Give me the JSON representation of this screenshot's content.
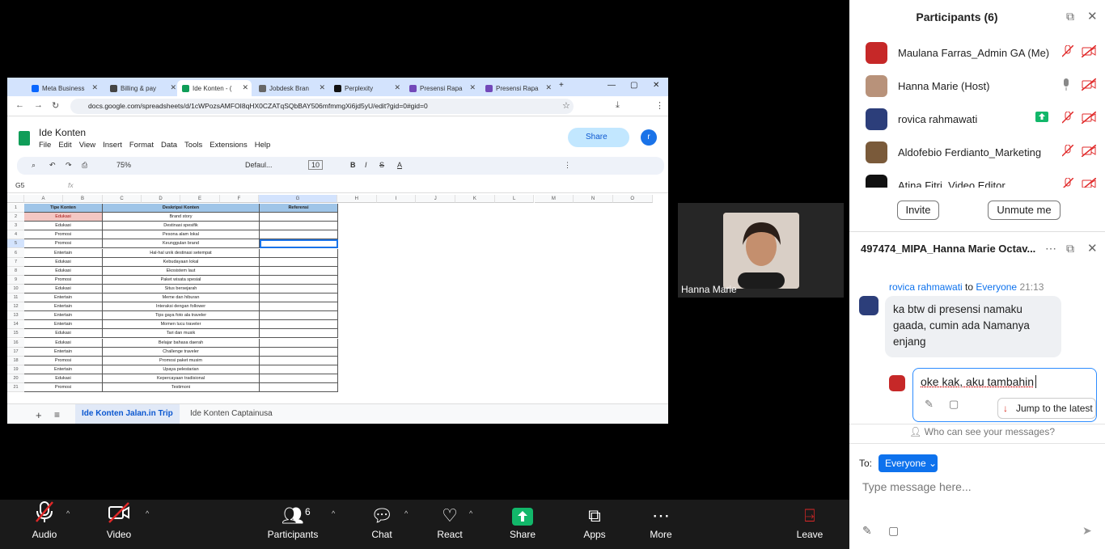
{
  "browser": {
    "tabs": [
      {
        "label": "Meta Business",
        "color": "#0866ff"
      },
      {
        "label": "Billing & pay",
        "color": "#444"
      },
      {
        "label": "Ide Konten - (",
        "color": "#0f9d58"
      },
      {
        "label": "Jobdesk Bran",
        "color": "#666"
      },
      {
        "label": "Perplexity",
        "color": "#111"
      },
      {
        "label": "Presensi Rapa",
        "color": "#7248b9"
      },
      {
        "label": "Presensi Rapa",
        "color": "#7248b9"
      }
    ],
    "url": "docs.google.com/spreadsheets/d/1cWPozsAMFOI8qHX0CZATqSQbBAY506mfmmgXi6jd5yU/edit?gid=0#gid=0"
  },
  "sheet": {
    "title": "Ide Konten",
    "menus": [
      "File",
      "Edit",
      "View",
      "Insert",
      "Format",
      "Data",
      "Tools",
      "Extensions",
      "Help"
    ],
    "share_label": "Share",
    "avatar_letter": "r",
    "zoom": "75%",
    "font": "Defaul...",
    "font_size": "10",
    "cell_ref": "G5",
    "fx": "fx",
    "columns": [
      "A",
      "B",
      "C",
      "D",
      "E",
      "F",
      "G",
      "H",
      "I",
      "J",
      "K",
      "L",
      "M",
      "N",
      "O"
    ],
    "headers": {
      "tipe": "Tipe Konten",
      "deskripsi": "Deskripsi Konten",
      "referensi": "Referensi"
    },
    "rows": [
      {
        "tipe": "Edukasi",
        "desc": "Brand story"
      },
      {
        "tipe": "Edukasi",
        "desc": "Destinasi spesifik"
      },
      {
        "tipe": "Promosi",
        "desc": "Pesona alam lokal"
      },
      {
        "tipe": "Promosi",
        "desc": "Keunggulan brand"
      },
      {
        "tipe": "Entertain",
        "desc": "Hal-hal unik destinasi setempat"
      },
      {
        "tipe": "Edukasi",
        "desc": "Kebudayaan lokal"
      },
      {
        "tipe": "Edukasi",
        "desc": "Ekosistem laut"
      },
      {
        "tipe": "Promosi",
        "desc": "Paket wisata spesial"
      },
      {
        "tipe": "Edukasi",
        "desc": "Situs bersejarah"
      },
      {
        "tipe": "Entertain",
        "desc": "Meme dan hiburan"
      },
      {
        "tipe": "Entertain",
        "desc": "Interaksi dengan follower"
      },
      {
        "tipe": "Entertain",
        "desc": "Tips gaya foto ala traveler"
      },
      {
        "tipe": "Entertain",
        "desc": "Momen lucu traveler"
      },
      {
        "tipe": "Edukasi",
        "desc": "Tari dan musik"
      },
      {
        "tipe": "Edukasi",
        "desc": "Belajar bahasa daerah"
      },
      {
        "tipe": "Entertain",
        "desc": "Challenge traveler"
      },
      {
        "tipe": "Promosi",
        "desc": "Promosi paket musim"
      },
      {
        "tipe": "Entertain",
        "desc": "Upaya pelestarian"
      },
      {
        "tipe": "Edukasi",
        "desc": "Kepercayaan tradisional"
      },
      {
        "tipe": "Promosi",
        "desc": "Testimoni"
      }
    ],
    "sheet_tabs": [
      "Ide Konten Jalan.in Trip",
      "Ide Konten Captainusa"
    ]
  },
  "video": {
    "name": "Hanna Marie"
  },
  "participants": {
    "title": "Participants (6)",
    "list": [
      {
        "name": "Maulana Farras_Admin GA (Me)",
        "color": "#c62828"
      },
      {
        "name": "Hanna Marie (Host)",
        "color": "#b8927a"
      },
      {
        "name": "rovica rahmawati",
        "color": "#2c3e7a"
      },
      {
        "name": "Aldofebio Ferdianto_Marketing",
        "color": "#7a5a3a"
      },
      {
        "name": "Atina Fitri_Video Editor",
        "color": "#111"
      }
    ],
    "invite": "Invite",
    "unmute": "Unmute me"
  },
  "chat": {
    "title": "497474_MIPA_Hanna Marie Octav...",
    "sender": "rovica rahmawati",
    "to": "to",
    "recipient": "Everyone",
    "time": "21:13",
    "message": "ka btw di presensi namaku gaada, cumin ada Namanya enjang",
    "draft": "oke kak, aku tambahin",
    "jump": "Jump to the latest",
    "who_can_see": "Who can see your messages?",
    "to_label": "To:",
    "to_value": "Everyone",
    "placeholder": "Type message here..."
  },
  "bottombar": {
    "audio": "Audio",
    "video": "Video",
    "participants": "Participants",
    "participants_count": "6",
    "chat": "Chat",
    "react": "React",
    "share": "Share",
    "apps": "Apps",
    "more": "More",
    "leave": "Leave"
  }
}
